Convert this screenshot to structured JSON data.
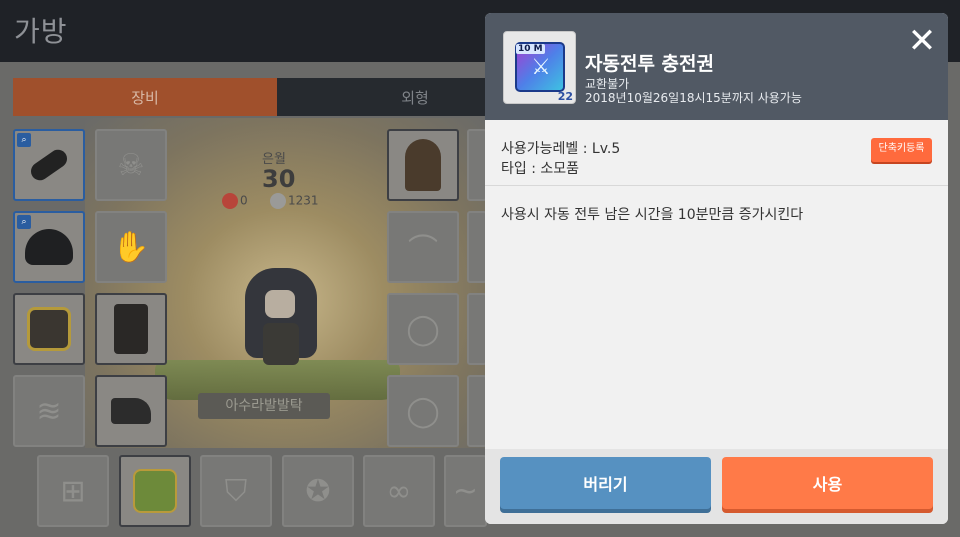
{
  "window": {
    "title": "가방"
  },
  "tabs": {
    "equip": "장비",
    "cosmetic": "외형"
  },
  "character": {
    "stat_label": "은월",
    "level": "30",
    "stat_a": "0",
    "stat_b": "1231",
    "name": "아수라발발탁"
  },
  "popup": {
    "item_name": "자동전투 충전권",
    "trade": "교환불가",
    "expiry": "2018년10월26일18시15분까지 사용가능",
    "icon_badge": "10 M",
    "icon_count": "22",
    "close_label": "✕",
    "level_req": "사용가능레벨 : Lv.5",
    "type": "타입 : 소모품",
    "shortcut_label": "단축키등록",
    "description": "사용시 자동 전투 남은 시간을 10분만큼 증가시킨다",
    "discard_label": "버리기",
    "use_label": "사용"
  },
  "colors": {
    "accent_orange": "#ff7a48",
    "accent_blue": "#5691c1",
    "header_slate": "#515964"
  }
}
